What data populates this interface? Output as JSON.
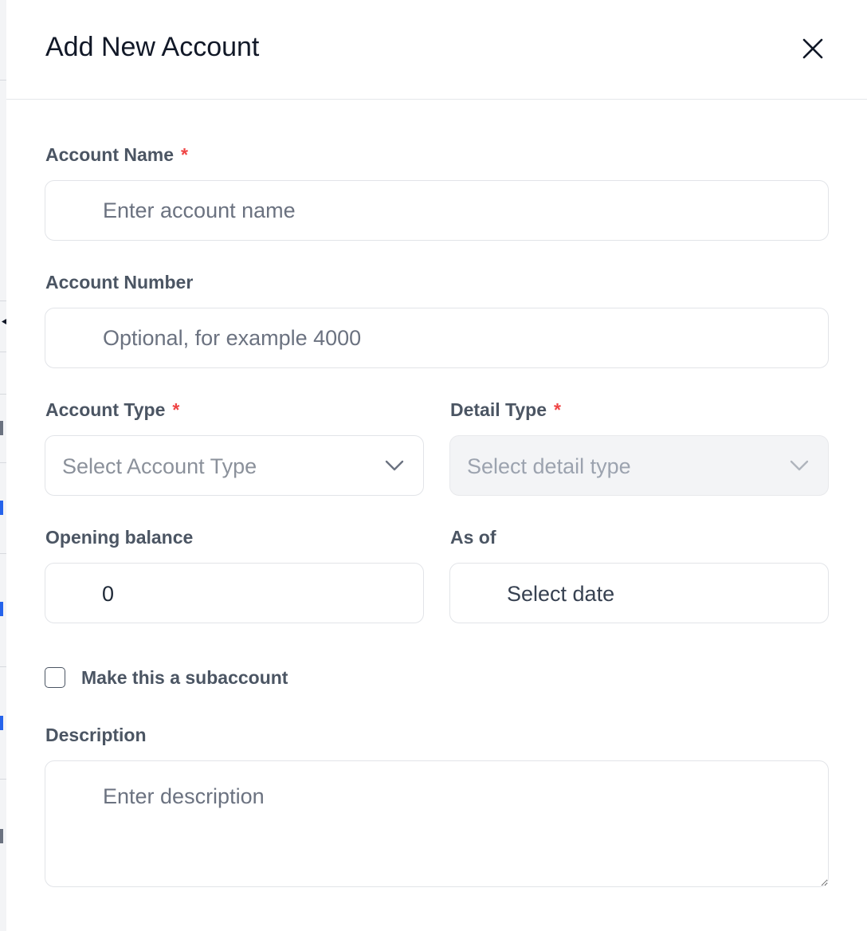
{
  "drawer": {
    "title": "Add New Account"
  },
  "form": {
    "account_name": {
      "label": "Account Name",
      "required_mark": "*",
      "placeholder": "Enter account name"
    },
    "account_number": {
      "label": "Account Number",
      "placeholder": "Optional, for example 4000"
    },
    "account_type": {
      "label": "Account Type",
      "required_mark": "*",
      "placeholder": "Select Account Type"
    },
    "detail_type": {
      "label": "Detail Type",
      "required_mark": "*",
      "placeholder": "Select detail type",
      "disabled": true
    },
    "opening_balance": {
      "label": "Opening balance",
      "value": "0"
    },
    "as_of": {
      "label": "As of",
      "placeholder": "Select date"
    },
    "subaccount": {
      "label": "Make this a subaccount",
      "checked": false
    },
    "description": {
      "label": "Description",
      "placeholder": "Enter description"
    }
  },
  "icons": {
    "close": "close-icon",
    "chevron": "chevron-down-icon"
  },
  "colors": {
    "required": "#ef4444",
    "label": "#4b5563",
    "title": "#111827",
    "border": "#e2e4e8",
    "disabled_bg": "#f3f4f6",
    "backdrop_link": "#2563eb"
  }
}
